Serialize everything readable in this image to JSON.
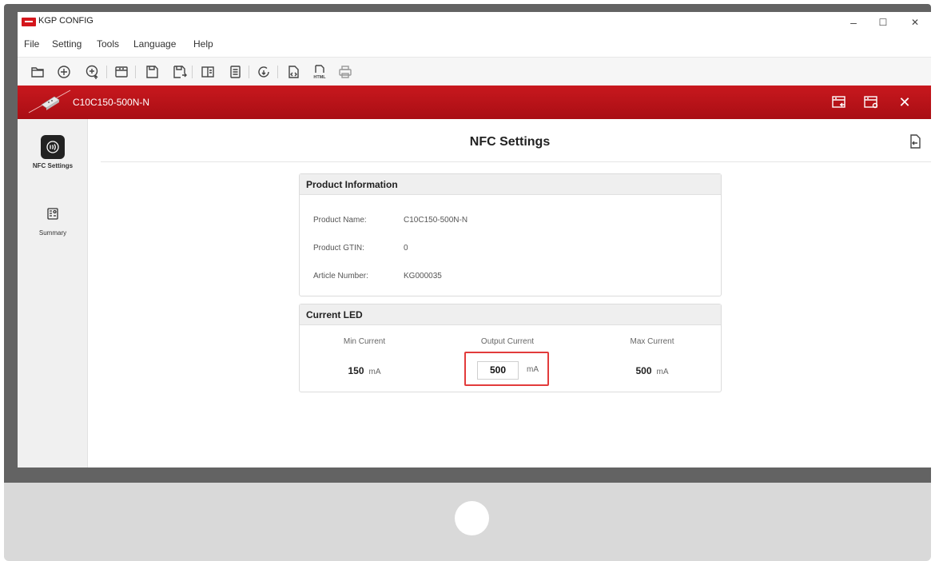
{
  "window": {
    "title": "KGP CONFIG",
    "minimize": "–",
    "maximize": "☐",
    "close": "✕"
  },
  "menu": [
    "File",
    "Setting",
    "Tools",
    "Language",
    "Help"
  ],
  "toolbar": {
    "icons": [
      "open-folder-icon",
      "add-circle-icon",
      "add-upload-icon",
      "device-read-icon",
      "save-icon",
      "save-as-icon",
      "compare-icon",
      "document-icon",
      "refresh-download-icon",
      "code-file-icon",
      "html-export-icon",
      "print-icon"
    ],
    "html_label": "HTML"
  },
  "device_bar": {
    "device_name": "C10C150-500N-N",
    "close": "✕"
  },
  "sidebar": {
    "items": [
      {
        "label": "NFC Settings",
        "icon": "nfc-icon",
        "active": true
      },
      {
        "label": "Summary",
        "icon": "summary-icon",
        "active": false
      }
    ]
  },
  "page": {
    "title": "NFC Settings"
  },
  "product_info": {
    "heading": "Product Information",
    "rows": [
      {
        "label": "Product Name:",
        "value": "C10C150-500N-N"
      },
      {
        "label": "Product GTIN:",
        "value": "0"
      },
      {
        "label": "Article Number:",
        "value": "KG000035"
      }
    ]
  },
  "current_led": {
    "heading": "Current LED",
    "min_label": "Min Current",
    "min_value": "150",
    "output_label": "Output Current",
    "output_value": "500",
    "max_label": "Max Current",
    "max_value": "500",
    "unit": "mA"
  },
  "colors": {
    "brand_red": "#c8181e",
    "highlight": "#e23b3b"
  }
}
